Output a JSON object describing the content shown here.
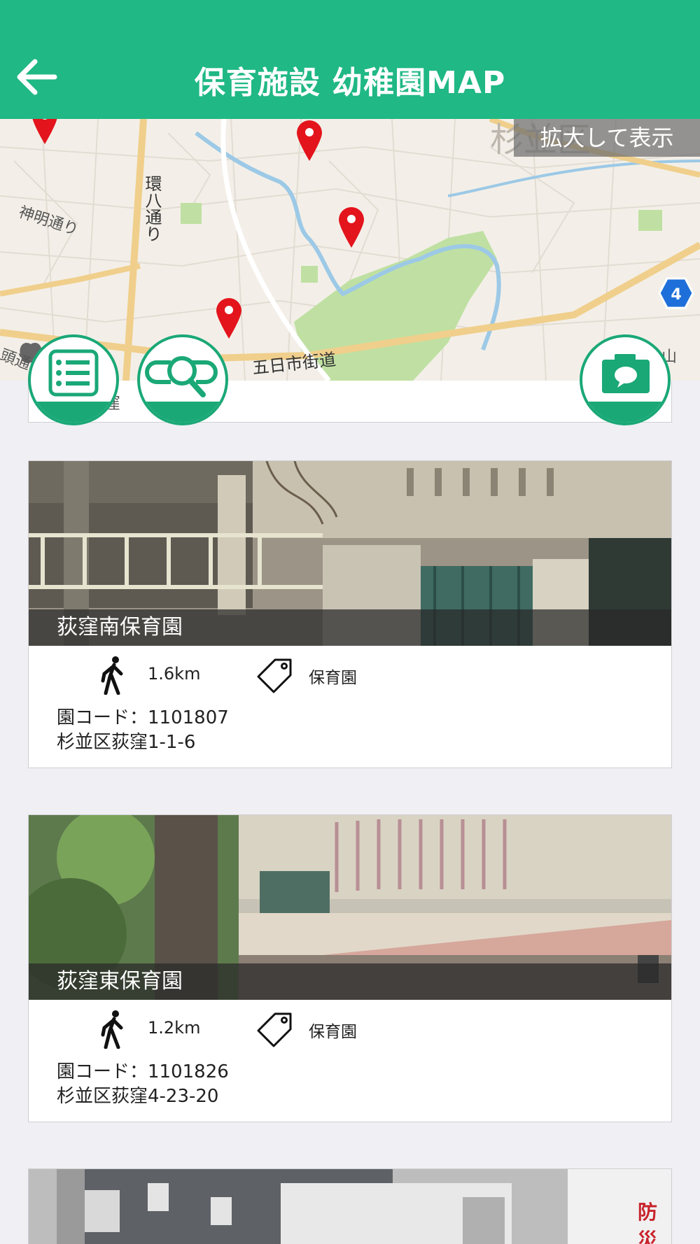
{
  "header": {
    "back_icon": "arrow-left-icon",
    "title": "保育施設 幼稚園MAP",
    "color": "#20b884"
  },
  "map": {
    "expand_label": "拡大して表示",
    "route_badge": "4",
    "labels": {
      "kanpachi": "環八通り",
      "shinmei": "神明通り",
      "itsukaichi": "五日市街道",
      "district": "杉並区",
      "edge_left": "頭通り",
      "edge_right": "山"
    },
    "pin_color": "#e3141c"
  },
  "strip": {
    "text": "荻窪"
  },
  "buttons": {
    "list": "list-icon",
    "search": "search-icon",
    "camera": "camera-icon",
    "accent": "#1aa877"
  },
  "facilities": [
    {
      "name": "荻窪南保育園",
      "distance": "1.6km",
      "category": "保育園",
      "code_line": "園コード：1101807",
      "address": "杉並区荻窪1-1-6"
    },
    {
      "name": "荻窪東保育園",
      "distance": "1.2km",
      "category": "保育園",
      "code_line": "園コード：1101826",
      "address": "杉並区荻窪4-23-20"
    },
    {
      "name": "",
      "sign_text": "防災"
    }
  ]
}
